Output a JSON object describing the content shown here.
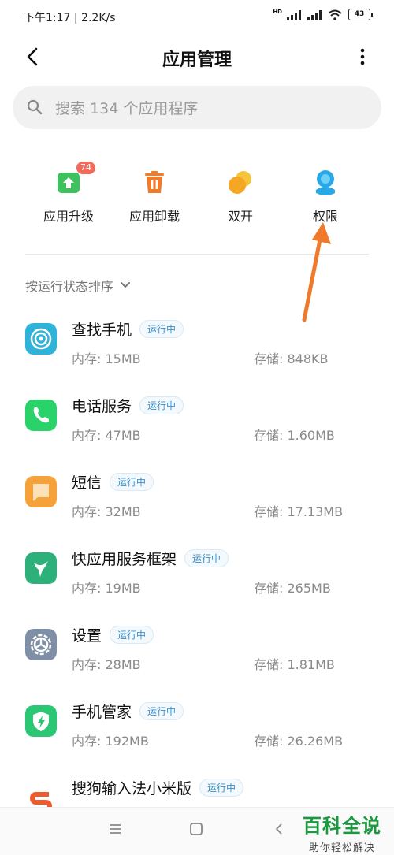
{
  "status_bar": {
    "time_speed": "下午1:17 | 2.2K/s",
    "hd_label": "HD",
    "battery": "43"
  },
  "header": {
    "title": "应用管理",
    "back_icon": "back-arrow-icon",
    "more_icon": "more-vertical-icon"
  },
  "search": {
    "placeholder": "搜索 134 个应用程序",
    "value": ""
  },
  "actions": [
    {
      "label": "应用升级",
      "icon": "upgrade-icon",
      "badge": "74",
      "color": "#3dc25f"
    },
    {
      "label": "应用卸载",
      "icon": "trash-icon",
      "color": "#f07b2b"
    },
    {
      "label": "双开",
      "icon": "dual-app-icon",
      "color": "#f5a623"
    },
    {
      "label": "权限",
      "icon": "permission-icon",
      "color": "#29a8e8"
    }
  ],
  "sort": {
    "label": "按运行状态排序"
  },
  "apps": [
    {
      "name": "查找手机",
      "status": "运行中",
      "memory": "内存: 15MB",
      "storage": "存储: 848KB",
      "icon": "find-phone-icon",
      "color": "#2fb3d8"
    },
    {
      "name": "电话服务",
      "status": "运行中",
      "memory": "内存: 47MB",
      "storage": "存储: 1.60MB",
      "icon": "phone-icon",
      "color": "#2ad36a"
    },
    {
      "name": "短信",
      "status": "运行中",
      "memory": "内存: 32MB",
      "storage": "存储: 17.13MB",
      "icon": "message-icon",
      "color": "#f6a23b"
    },
    {
      "name": "快应用服务框架",
      "status": "运行中",
      "memory": "内存: 19MB",
      "storage": "存储: 265MB",
      "icon": "quick-app-icon",
      "color": "#2eb07a"
    },
    {
      "name": "设置",
      "status": "运行中",
      "memory": "内存: 28MB",
      "storage": "存储: 1.81MB",
      "icon": "settings-icon",
      "color": "#7f8fa6"
    },
    {
      "name": "手机管家",
      "status": "运行中",
      "memory": "内存: 192MB",
      "storage": "存储: 26.26MB",
      "icon": "security-icon",
      "color": "#2cc774"
    },
    {
      "name": "搜狗输入法小米版",
      "status": "运行中",
      "memory": "",
      "storage": "",
      "icon": "sogou-icon",
      "color": "#ee5a2b"
    }
  ],
  "watermark": {
    "title": "百科全说",
    "subtitle": "助你轻松解决"
  },
  "colors": {
    "accent_arrow": "#f07a2b",
    "status_tag": "#3a8fc7"
  }
}
